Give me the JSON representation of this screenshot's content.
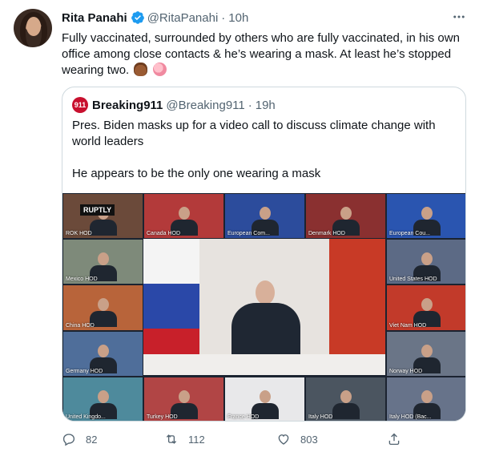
{
  "tweet": {
    "author_name": "Rita Panahi",
    "author_handle": "@RitaPanahi",
    "separator": "·",
    "time": "10h",
    "text": "Fully vaccinated, surrounded by others who are fully vaccinated, in his own office among close contacts & he’s wearing a mask. At least he’s stopped wearing two.",
    "emojis": [
      "pile-of-poo-emoji",
      "brain-emoji"
    ]
  },
  "quote": {
    "avatar_text": "911",
    "author_name": "Breaking911",
    "author_handle": "@Breaking911",
    "separator": "·",
    "time": "19h",
    "paragraph1": "Pres. Biden masks up for a video call to discuss climate change with world leaders",
    "paragraph2": "He appears to be the only one wearing a mask"
  },
  "media": {
    "watermark": "RUPTLY",
    "tiles": [
      {
        "label": "ROK HOD",
        "color": "#6b4a3a"
      },
      {
        "label": "Canada HOD",
        "color": "#b33a3a"
      },
      {
        "label": "European Com...",
        "color": "#2c4c9c"
      },
      {
        "label": "Denmark HOD",
        "color": "#8a3030"
      },
      {
        "label": "European Cou...",
        "color": "#2a55b0"
      },
      {
        "label": "Mexico HOD",
        "color": "#7e8a7a"
      },
      {
        "label": "United States HOD",
        "color": "#5c6a85"
      },
      {
        "label": "China HOD",
        "color": "#b8643a"
      },
      {
        "label": "Viet Nam HOD",
        "color": "#c23a2a"
      },
      {
        "label": "Germany HOD",
        "color": "#4f6e9a"
      },
      {
        "label": "Norway HOD",
        "color": "#6a7587"
      },
      {
        "label": "United Kingdo...",
        "color": "#4e8a9c"
      },
      {
        "label": "Turkey HOD",
        "color": "#b14545"
      },
      {
        "label": "France HOD",
        "color": "#e8e8ea"
      },
      {
        "label": "Italy HOD",
        "color": "#4b5560"
      },
      {
        "label": "Italy HOD (Bac...",
        "color": "#67738a"
      }
    ]
  },
  "actions": {
    "reply_count": "82",
    "retweet_count": "112",
    "like_count": "803"
  },
  "colors": {
    "text_primary": "#0f1419",
    "text_secondary": "#536471",
    "verified_blue": "#1d9bf0",
    "border": "#cfd9de"
  }
}
